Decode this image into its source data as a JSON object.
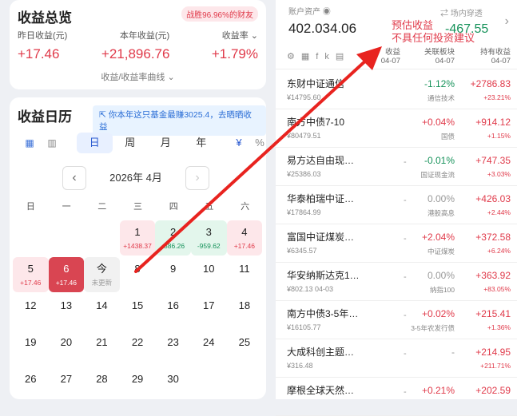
{
  "summary": {
    "title": "收益总览",
    "badge": "战胜96.96%的财友",
    "yesterday_label": "昨日收益(元)",
    "year_label": "本年收益(元)",
    "rate_label": "收益率",
    "yesterday_value": "+17.46",
    "year_value": "+21,896.76",
    "rate_value": "+1.79%",
    "curve_link": "收益/收益率曲线"
  },
  "calendar": {
    "title": "收益日历",
    "tip": "你本年这只基金最赚3025.4，去晒晒收益",
    "tabs": [
      "日",
      "周",
      "月",
      "年"
    ],
    "currency_icon": "¥",
    "percent_icon": "%",
    "month_label": "2026年 4月",
    "weekdays": [
      "日",
      "一",
      "二",
      "三",
      "四",
      "五",
      "六"
    ],
    "days": [
      {
        "d": "1",
        "v": "+1438.37",
        "s": "up"
      },
      {
        "d": "2",
        "v": "-886.26",
        "s": "down"
      },
      {
        "d": "3",
        "v": "-959.62",
        "s": "down"
      },
      {
        "d": "4",
        "v": "+17.46",
        "s": "up"
      },
      {
        "d": "5",
        "v": "+17.46",
        "s": "up"
      },
      {
        "d": "6",
        "v": "+17.46",
        "s": "today"
      },
      {
        "d": "今",
        "v": "未更新",
        "s": "nodata"
      },
      {
        "d": "8",
        "v": "",
        "s": ""
      },
      {
        "d": "9",
        "v": "",
        "s": ""
      },
      {
        "d": "10",
        "v": "",
        "s": ""
      },
      {
        "d": "11",
        "v": "",
        "s": ""
      },
      {
        "d": "12",
        "v": "",
        "s": ""
      },
      {
        "d": "13",
        "v": "",
        "s": ""
      },
      {
        "d": "14",
        "v": "",
        "s": ""
      },
      {
        "d": "15",
        "v": "",
        "s": ""
      },
      {
        "d": "16",
        "v": "",
        "s": ""
      },
      {
        "d": "17",
        "v": "",
        "s": ""
      },
      {
        "d": "18",
        "v": "",
        "s": ""
      },
      {
        "d": "19",
        "v": "",
        "s": ""
      },
      {
        "d": "20",
        "v": "",
        "s": ""
      },
      {
        "d": "21",
        "v": "",
        "s": ""
      },
      {
        "d": "22",
        "v": "",
        "s": ""
      },
      {
        "d": "23",
        "v": "",
        "s": ""
      },
      {
        "d": "24",
        "v": "",
        "s": ""
      },
      {
        "d": "25",
        "v": "",
        "s": ""
      },
      {
        "d": "26",
        "v": "",
        "s": ""
      },
      {
        "d": "27",
        "v": "",
        "s": ""
      },
      {
        "d": "28",
        "v": "",
        "s": ""
      },
      {
        "d": "29",
        "v": "",
        "s": ""
      },
      {
        "d": "30",
        "v": "",
        "s": ""
      }
    ]
  },
  "account": {
    "label": "账户资产",
    "value": "402.034.06",
    "mode": "场内穿透",
    "estimate_label": "预估收益",
    "disclaimer": "不具任何投资建议",
    "estimate_value": "-467.55"
  },
  "table": {
    "col_est": "收益",
    "col_est_date": "04-07",
    "col_sector": "关联板块",
    "col_sector_date": "04-07",
    "col_hold": "持有收益",
    "col_hold_date": "04-07",
    "funds": [
      {
        "name": "东财中证通信",
        "sub": "¥14795.60",
        "dash": "",
        "chg": "-1.12%",
        "chg_color": "green",
        "sector": "通信技术",
        "hold": "+2786.83",
        "pct": "+23.21%"
      },
      {
        "name": "南方中债7-10",
        "sub": "¥80479.51",
        "dash": "",
        "chg": "+0.04%",
        "chg_color": "red",
        "sector": "国债",
        "hold": "+914.12",
        "pct": "+1.15%"
      },
      {
        "name": "易方达自由现…",
        "sub": "¥25386.03",
        "dash": "-",
        "chg": "-0.01%",
        "chg_color": "green",
        "sector": "国证现金流",
        "hold": "+747.35",
        "pct": "+3.03%"
      },
      {
        "name": "华泰柏瑞中证…",
        "sub": "¥17864.99",
        "dash": "-",
        "chg": "0.00%",
        "chg_color": "gray",
        "sector": "港股高息",
        "hold": "+426.03",
        "pct": "+2.44%"
      },
      {
        "name": "富国中证煤炭…",
        "sub": "¥6345.57",
        "dash": "-",
        "chg": "+2.04%",
        "chg_color": "red",
        "sector": "中证煤炭",
        "hold": "+372.58",
        "pct": "+6.24%"
      },
      {
        "name": "华安纳斯达克1…",
        "sub": "¥802.13  04-03",
        "dash": "-",
        "chg": "0.00%",
        "chg_color": "gray",
        "sector": "纳指100",
        "hold": "+363.92",
        "pct": "+83.05%"
      },
      {
        "name": "南方中债3-5年…",
        "sub": "¥16105.77",
        "dash": "-",
        "chg": "+0.02%",
        "chg_color": "red",
        "sector": "3-5年农发行债",
        "hold": "+215.41",
        "pct": "+1.36%"
      },
      {
        "name": "大成科创主题…",
        "sub": "¥316.48",
        "dash": "-",
        "chg": "-",
        "chg_color": "gray",
        "sector": "",
        "hold": "+214.95",
        "pct": "+211.71%"
      },
      {
        "name": "摩根全球天然…",
        "sub": "",
        "dash": "-",
        "chg": "+0.21%",
        "chg_color": "red",
        "sector": "",
        "hold": "+202.59",
        "pct": ""
      }
    ]
  },
  "colors": {
    "red": "#e03a4a",
    "green": "#16925a",
    "blue": "#2a5ad0"
  }
}
